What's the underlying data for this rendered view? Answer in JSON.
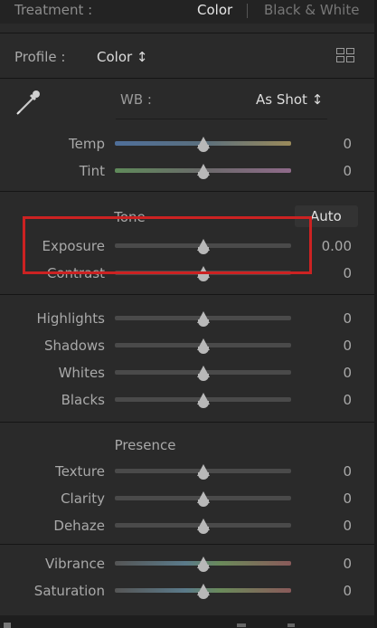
{
  "treatment": {
    "label": "Treatment :",
    "option_color": "Color",
    "option_bw": "Black & White"
  },
  "profile": {
    "label": "Profile :",
    "value": "Color ↕"
  },
  "wb": {
    "label": "WB :",
    "value": "As Shot ↕"
  },
  "sliders": {
    "temp": {
      "label": "Temp",
      "value": "0",
      "track_color": "#6b8fb0"
    },
    "tint": {
      "label": "Tint",
      "value": "0",
      "track_color": "#7c9a6a"
    },
    "exposure": {
      "label": "Exposure",
      "value": "0.00"
    },
    "contrast": {
      "label": "Contrast",
      "value": "0"
    },
    "highlights": {
      "label": "Highlights",
      "value": "0"
    },
    "shadows": {
      "label": "Shadows",
      "value": "0"
    },
    "whites": {
      "label": "Whites",
      "value": "0"
    },
    "blacks": {
      "label": "Blacks",
      "value": "0"
    },
    "texture": {
      "label": "Texture",
      "value": "0"
    },
    "clarity": {
      "label": "Clarity",
      "value": "0"
    },
    "dehaze": {
      "label": "Dehaze",
      "value": "0"
    },
    "vibrance": {
      "label": "Vibrance",
      "value": "0"
    },
    "saturation": {
      "label": "Saturation",
      "value": "0"
    }
  },
  "tone": {
    "title": "Tone",
    "auto": "Auto"
  },
  "presence": {
    "title": "Presence"
  },
  "colors": {
    "highlight_box": "#cc2222"
  }
}
